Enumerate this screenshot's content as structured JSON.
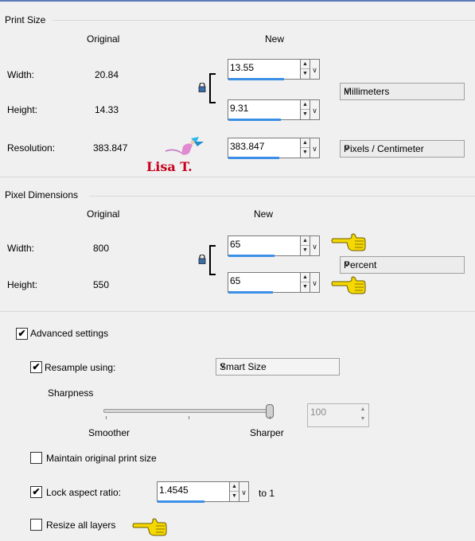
{
  "print_size": {
    "heading": "Print Size",
    "col_original": "Original",
    "col_new": "New",
    "width_label": "Width:",
    "width_original": "20.84",
    "width_new": "13.55",
    "height_label": "Height:",
    "height_original": "14.33",
    "height_new": "9.31",
    "resolution_label": "Resolution:",
    "resolution_original": "383.847",
    "resolution_new": "383.847",
    "units_select": "Millimeters",
    "res_units_select": "Pixels / Centimeter"
  },
  "pixel_dimensions": {
    "heading": "Pixel Dimensions",
    "col_original": "Original",
    "col_new": "New",
    "width_label": "Width:",
    "width_original": "800",
    "width_new": "65",
    "height_label": "Height:",
    "height_original": "550",
    "height_new": "65",
    "units_select": "Percent"
  },
  "watermark": {
    "text": "Lisa T."
  },
  "advanced": {
    "advanced_label": "Advanced settings",
    "advanced_checked": true,
    "resample_label": "Resample using:",
    "resample_checked": true,
    "resample_select": "Smart Size",
    "sharpness_label": "Sharpness",
    "sharpness_value": "100",
    "sharpness_level": 1.0,
    "smoother_label": "Smoother",
    "sharper_label": "Sharper",
    "maintain_label": "Maintain original print size",
    "maintain_checked": false,
    "lock_label": "Lock aspect ratio:",
    "lock_checked": true,
    "ratio_value": "1.4545",
    "ratio_suffix": "to 1",
    "resize_layers_label": "Resize all layers",
    "resize_layers_checked": false
  },
  "colors": {
    "accent_bar": "#3c8fe6",
    "watermark_red": "#c8001c",
    "pointer_yellow": "#f5d800"
  },
  "icons": [
    "lock-icon",
    "pointing-hand-icon",
    "fairy-icon",
    "chevron-down-icon",
    "spin-up-icon",
    "spin-down-icon",
    "checkmark-icon"
  ]
}
